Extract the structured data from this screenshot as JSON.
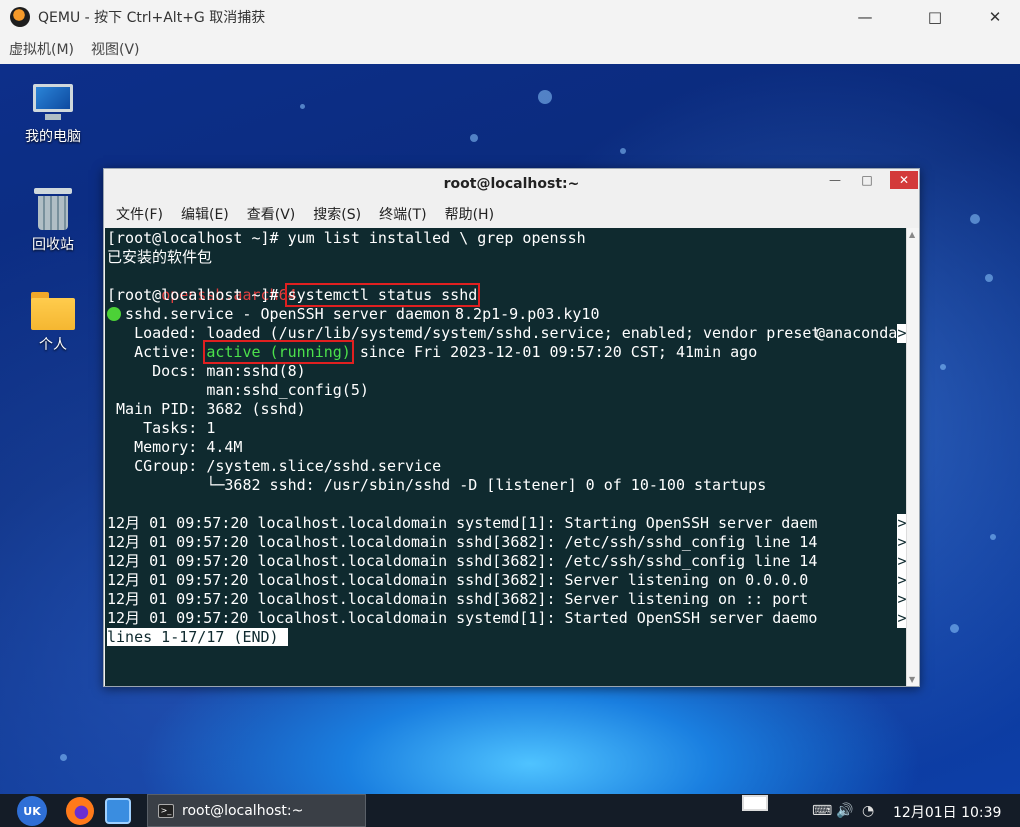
{
  "qemu": {
    "title": "QEMU - 按下 Ctrl+Alt+G 取消捕获",
    "menu": [
      "虚拟机(M)",
      "视图(V)"
    ]
  },
  "desktop": {
    "icons": [
      {
        "label": "我的电脑",
        "icon": "computer-icon"
      },
      {
        "label": "回收站",
        "icon": "trash-icon"
      },
      {
        "label": "个人",
        "icon": "home-folder-icon"
      }
    ]
  },
  "terminal": {
    "title": "root@localhost:~",
    "menu": [
      "文件(F)",
      "编辑(E)",
      "查看(V)",
      "搜索(S)",
      "终端(T)",
      "帮助(H)"
    ],
    "prompt": "[root@localhost ~]# ",
    "cmd1": "yum list installed \\ grep openssh",
    "line_installed": "已安装的软件包",
    "pkg_name": "openssh.aarch64",
    "pkg_version": "8.2p1-9.p03.ky10",
    "pkg_repo": "@anaconda",
    "cmd2": "systemctl status sshd",
    "service_line": "sshd.service - OpenSSH server daemon",
    "loaded": "   Loaded: loaded (/usr/lib/systemd/system/sshd.service; enabled; vendor preset",
    "active_prefix": "   Active: ",
    "active_state": "active (running)",
    "active_suffix": " since Fri 2023-12-01 09:57:20 CST; 41min ago",
    "docs1": "     Docs: man:sshd(8)",
    "docs2": "           man:sshd_config(5)",
    "mainpid": " Main PID: 3682 (sshd)",
    "tasks": "    Tasks: 1",
    "memory": "   Memory: 4.4M",
    "cgroup": "   CGroup: /system.slice/sshd.service",
    "cgroup_child": "           └─3682 sshd: /usr/sbin/sshd -D [listener] 0 of 10-100 startups",
    "log": [
      "12月 01 09:57:20 localhost.localdomain systemd[1]: Starting OpenSSH server daem",
      "12月 01 09:57:20 localhost.localdomain sshd[3682]: /etc/ssh/sshd_config line 14",
      "12月 01 09:57:20 localhost.localdomain sshd[3682]: /etc/ssh/sshd_config line 14",
      "12月 01 09:57:20 localhost.localdomain sshd[3682]: Server listening on 0.0.0.0 ",
      "12月 01 09:57:20 localhost.localdomain sshd[3682]: Server listening on :: port ",
      "12月 01 09:57:20 localhost.localdomain systemd[1]: Started OpenSSH server daemo"
    ],
    "truncation_marker": ">",
    "pager_status": "lines 1-17/17 (END)"
  },
  "taskbar": {
    "start_label": "UK",
    "task_label": "root@localhost:~",
    "clock": "12月01日 10:39"
  },
  "colors": {
    "terminal_bg": "#0f2a2f",
    "highlight_box": "#e02020",
    "active_green": "#4be04b",
    "package_red": "#e04040"
  }
}
